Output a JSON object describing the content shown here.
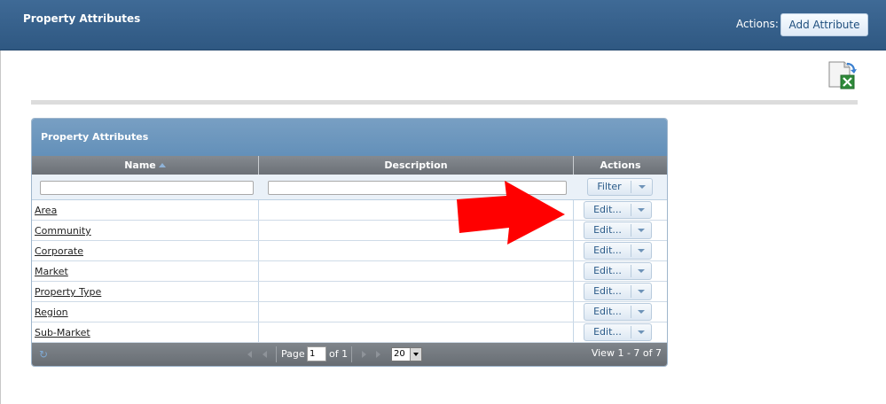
{
  "header": {
    "title": "Property Attributes",
    "actions_label": "Actions:",
    "add_button_label": "Add Attribute"
  },
  "toolbar": {
    "export_icon": "excel-export-icon"
  },
  "grid": {
    "caption": "Property Attributes",
    "columns": [
      {
        "label": "Name",
        "sorted": "ascending"
      },
      {
        "label": "Description"
      },
      {
        "label": "Actions"
      }
    ],
    "filter": {
      "name_value": "",
      "description_value": "",
      "button_label": "Filter"
    },
    "rows": [
      {
        "name": "Area",
        "description": "",
        "action": "Edit..."
      },
      {
        "name": "Community",
        "description": "",
        "action": "Edit..."
      },
      {
        "name": "Corporate",
        "description": "",
        "action": "Edit..."
      },
      {
        "name": "Market",
        "description": "",
        "action": "Edit..."
      },
      {
        "name": "Property Type",
        "description": "",
        "action": "Edit..."
      },
      {
        "name": "Region",
        "description": "",
        "action": "Edit..."
      },
      {
        "name": "Sub-Market",
        "description": "",
        "action": "Edit..."
      }
    ],
    "pager": {
      "page_label": "Page",
      "current_page": "1",
      "of_label": "of 1",
      "page_size": "20",
      "view_summary": "View 1 - 7 of 7"
    }
  },
  "colors": {
    "header_bg": "#335c87",
    "grid_caption_bg": "#6b95be",
    "column_header_bg": "#767b81",
    "annotation_arrow": "#ff0000"
  }
}
